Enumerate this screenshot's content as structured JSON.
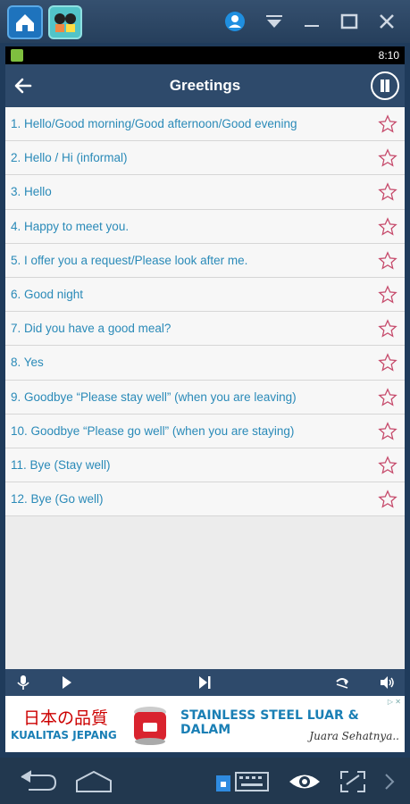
{
  "status_bar": {
    "time": "8:10"
  },
  "app_bar": {
    "title": "Greetings"
  },
  "phrases": [
    {
      "label": "1. Hello/Good morning/Good afternoon/Good evening"
    },
    {
      "label": "2. Hello / Hi (informal)"
    },
    {
      "label": "3. Hello"
    },
    {
      "label": "4. Happy to meet you."
    },
    {
      "label": "5. I offer you a request/Please look after me."
    },
    {
      "label": "6. Good night"
    },
    {
      "label": "7. Did you have a good meal?"
    },
    {
      "label": "8. Yes"
    },
    {
      "label": "9. Goodbye “Please stay well” (when you are leaving)"
    },
    {
      "label": "10. Goodbye “Please go well” (when you are staying)"
    },
    {
      "label": "11. Bye (Stay well)"
    },
    {
      "label": "12. Bye (Go well)"
    }
  ],
  "ad": {
    "japanese_text": "日本の品質",
    "kualitas": "KUALITAS JEPANG",
    "headline": "STAINLESS STEEL LUAR & DALAM",
    "tagline": "Juara Sehatnya..",
    "badge": "▷ ✕"
  },
  "colors": {
    "app_bar": "#2e4a6b",
    "phrase_text": "#2a8ab8",
    "star": "#c64a6b",
    "emulator": "#22384f"
  },
  "icons": {
    "back": "arrow-left-icon",
    "book": "book-icon",
    "star": "star-outline-icon",
    "mic": "microphone-icon",
    "play": "play-icon",
    "skip": "skip-next-icon",
    "repeat": "repeat-icon",
    "volume": "volume-icon"
  }
}
